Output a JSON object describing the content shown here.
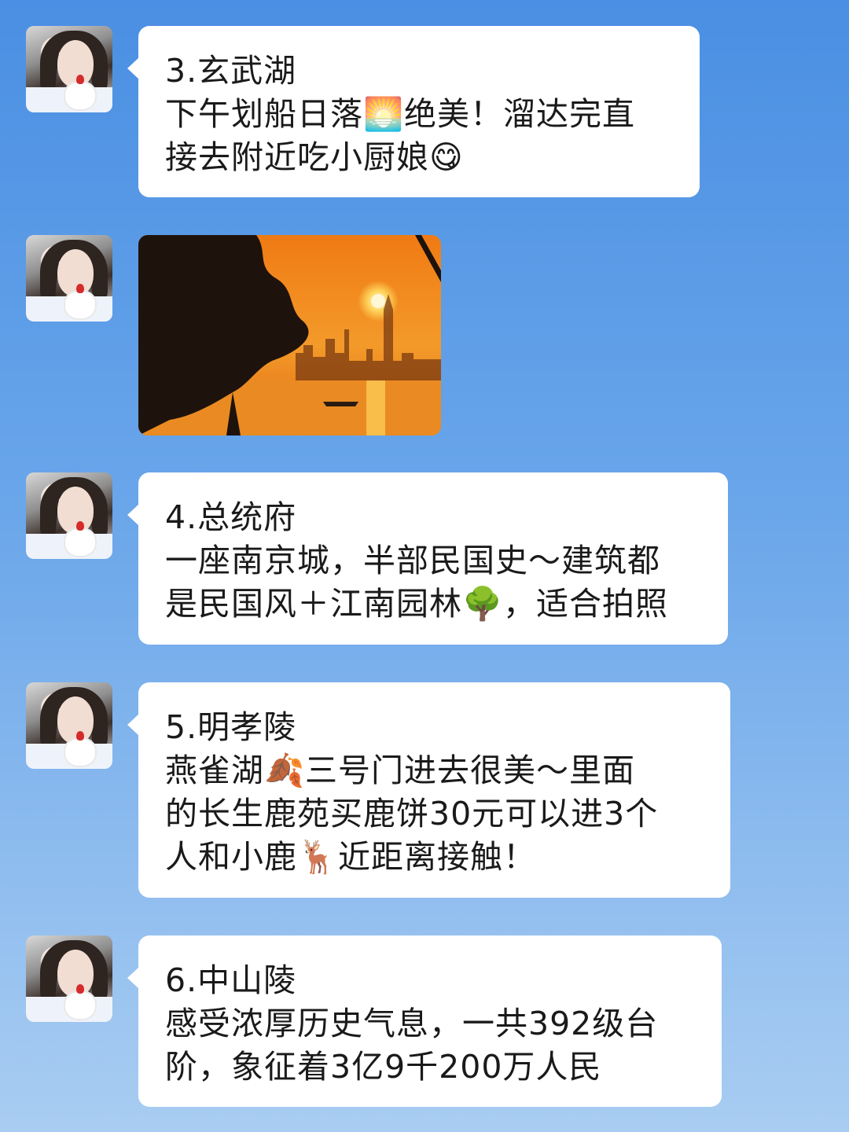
{
  "messages": [
    {
      "title": "3.玄武湖",
      "lines": [
        "下午划船日落🌅绝美！溜达完直",
        "接去附近吃小厨娘😋"
      ]
    },
    {
      "photo": "sunset over lake with tree silhouette and skyline"
    },
    {
      "title": "4.总统府",
      "lines": [
        "一座南京城，半部民国史～建筑都",
        "是民国风＋江南园林🌳，适合拍照"
      ]
    },
    {
      "title": "5.明孝陵",
      "lines": [
        "燕雀湖🍂三号门进去很美～里面",
        "的长生鹿苑买鹿饼30元可以进3个",
        "人和小鹿🦌近距离接触！"
      ]
    },
    {
      "title": "6.中山陵",
      "lines": [
        "感受浓厚历史气息，一共392级台",
        "阶，象征着3亿9千200万人民"
      ]
    }
  ],
  "colors": {
    "bubble": "#ffffff",
    "bg_top": "#4a8fe3",
    "bg_bottom": "#a9cdf2"
  }
}
